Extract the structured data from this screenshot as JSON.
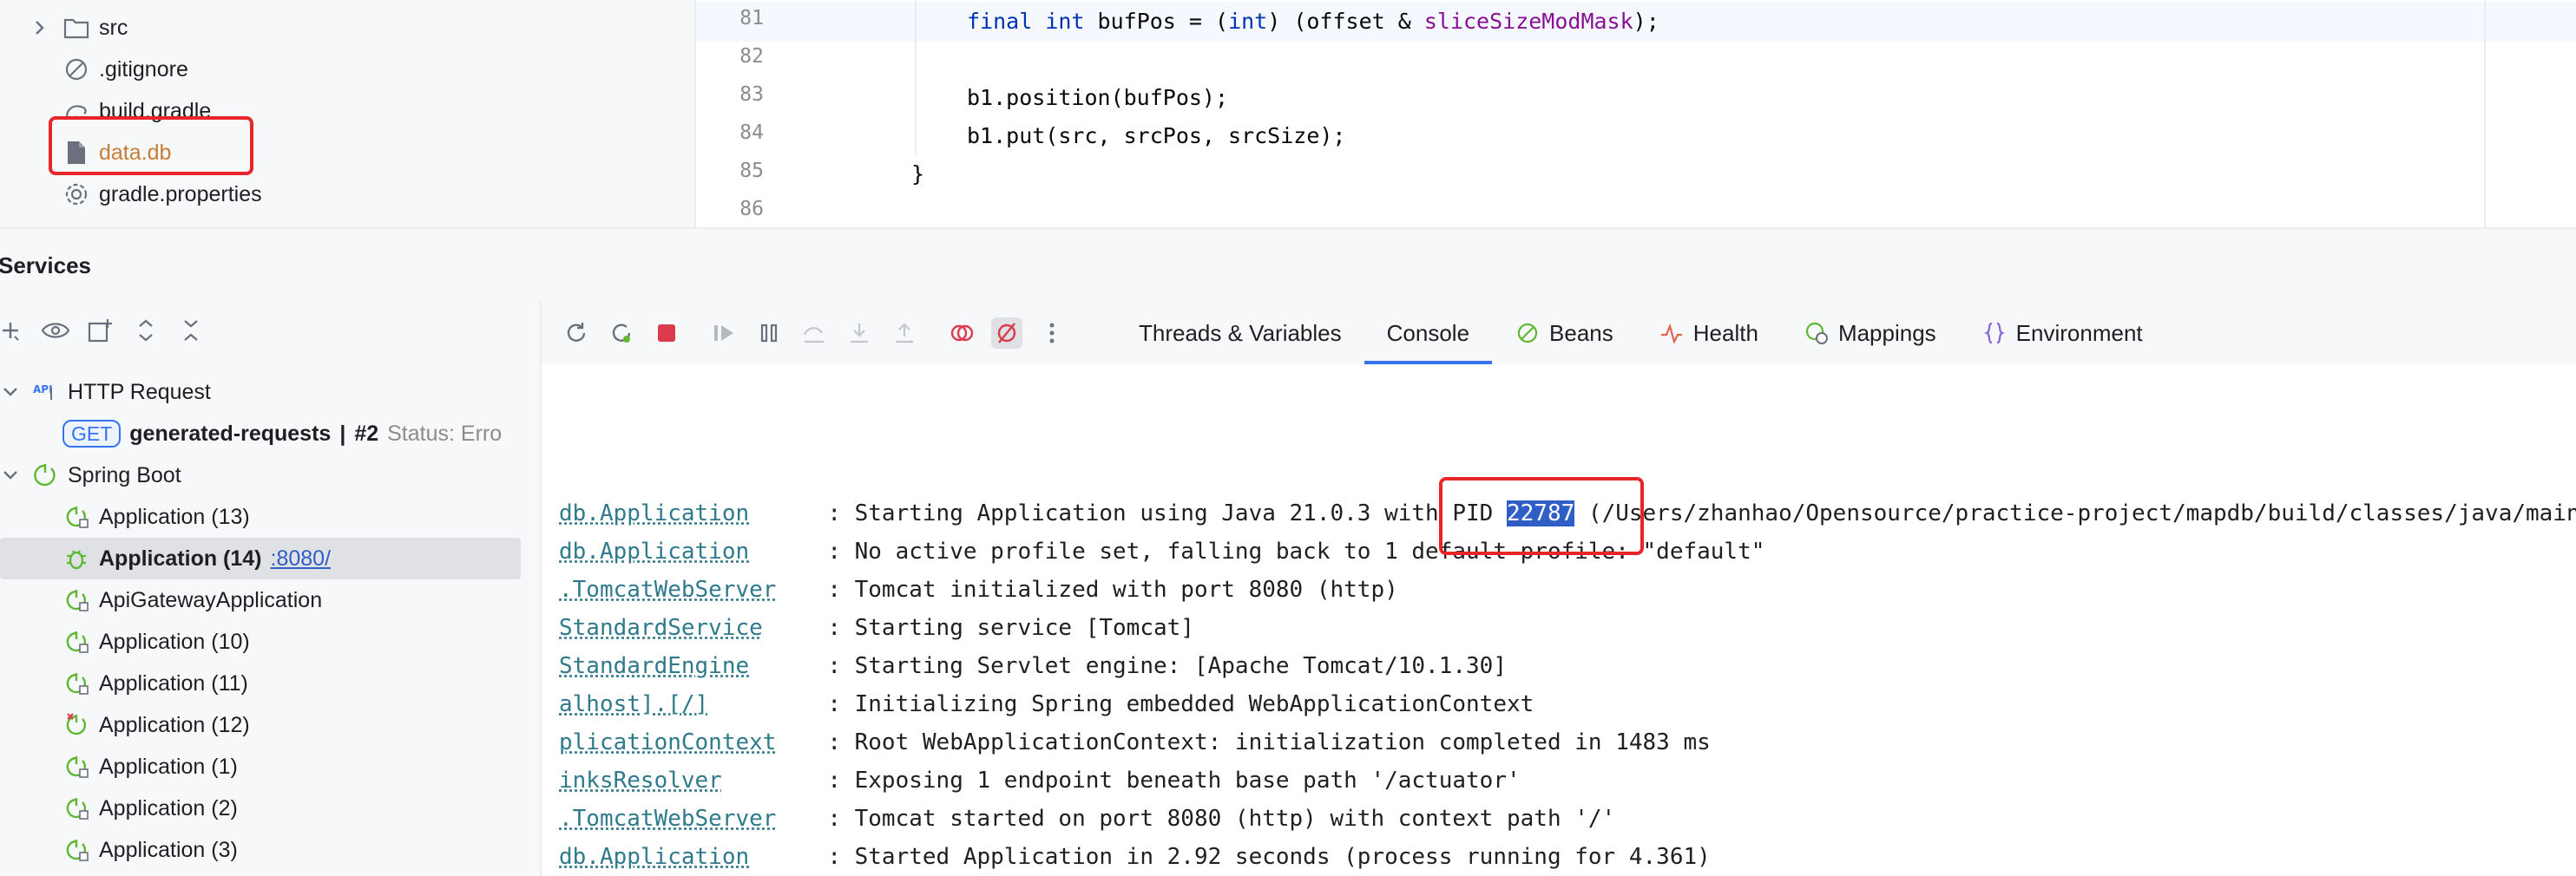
{
  "project_tree": {
    "items": [
      {
        "label": "src",
        "icon": "folder-icon",
        "has_chevron": true
      },
      {
        "label": ".gitignore",
        "icon": "ignore-icon"
      },
      {
        "label": "build.gradle",
        "icon": "gradle-icon"
      },
      {
        "label": "data.db",
        "icon": "file-icon",
        "highlighted": true
      },
      {
        "label": "gradle.properties",
        "icon": "settings-file-icon"
      }
    ]
  },
  "editor": {
    "lines": [
      {
        "no": "81",
        "parts": [
          "final",
          " ",
          "int",
          " bufPos = (",
          "int",
          ") (offset & ",
          "sliceSizeModMask",
          ");"
        ]
      },
      {
        "no": "82",
        "text": ""
      },
      {
        "no": "83",
        "text": "b1.position(bufPos);"
      },
      {
        "no": "84",
        "text": "b1.put(src, srcPos, srcSize);"
      },
      {
        "no": "85",
        "text": "}"
      },
      {
        "no": "86",
        "text": ""
      }
    ]
  },
  "services": {
    "title": "Services",
    "tree": {
      "http_request": "HTTP Request",
      "get_badge": "GET",
      "request_name": "generated-requests",
      "request_sep": "|",
      "request_num": "#2",
      "request_status": "Status: Erro",
      "spring_boot": "Spring Boot",
      "apps": [
        {
          "label": "Application (13)",
          "state": "stopped"
        },
        {
          "label": "Application (14)",
          "state": "debugging",
          "selected": true,
          "port": ":8080/"
        },
        {
          "label": "ApiGatewayApplication",
          "state": "stopped"
        },
        {
          "label": "Application (10)",
          "state": "stopped"
        },
        {
          "label": "Application (11)",
          "state": "stopped"
        },
        {
          "label": "Application (12)",
          "state": "error"
        },
        {
          "label": "Application (1)",
          "state": "stopped"
        },
        {
          "label": "Application (2)",
          "state": "stopped"
        },
        {
          "label": "Application (3)",
          "state": "stopped"
        }
      ]
    },
    "tabs": [
      {
        "label": "Threads & Variables",
        "icon": ""
      },
      {
        "label": "Console",
        "icon": "",
        "active": true
      },
      {
        "label": "Beans",
        "icon": "beans-icon"
      },
      {
        "label": "Health",
        "icon": "health-icon"
      },
      {
        "label": "Mappings",
        "icon": "mappings-icon"
      },
      {
        "label": "Environment",
        "icon": "environment-icon"
      }
    ],
    "console": {
      "lines": [
        {
          "logger": "db.Application",
          "pre": ": Starting Application using Java 21.0.3 with PID ",
          "sel": "22787",
          "post": " (/Users/zhanhao/Opensource/practice-project/mapdb/build/classes/java/main st"
        },
        {
          "logger": "db.Application",
          "pre": ": No active profile set, falling back to 1 default profile: \"default\""
        },
        {
          "logger": ".TomcatWebServer",
          "pre": ": Tomcat initialized with port 8080 (http)"
        },
        {
          "logger": "StandardService",
          "pre": ": Starting service [Tomcat]"
        },
        {
          "logger": "StandardEngine",
          "pre": ": Starting Servlet engine: [Apache Tomcat/10.1.30]"
        },
        {
          "logger": "alhost].[/]",
          "pre": ": Initializing Spring embedded WebApplicationContext"
        },
        {
          "logger": "plicationContext",
          "pre": ": Root WebApplicationContext: initialization completed in 1483 ms"
        },
        {
          "logger": "inksResolver",
          "pre": ": Exposing 1 endpoint beneath base path '/actuator'"
        },
        {
          "logger": ".TomcatWebServer",
          "pre": ": Tomcat started on port 8080 (http) with context path '/'"
        },
        {
          "logger": "db.Application",
          "pre": ": Started Application in 2.92 seconds (process running for 4.361)"
        }
      ]
    }
  },
  "colors": {
    "highlight_box": "#e8262a",
    "accent": "#3574f0",
    "keyword": "#0033b3",
    "field": "#871094",
    "spring_green": "#5fb832"
  }
}
